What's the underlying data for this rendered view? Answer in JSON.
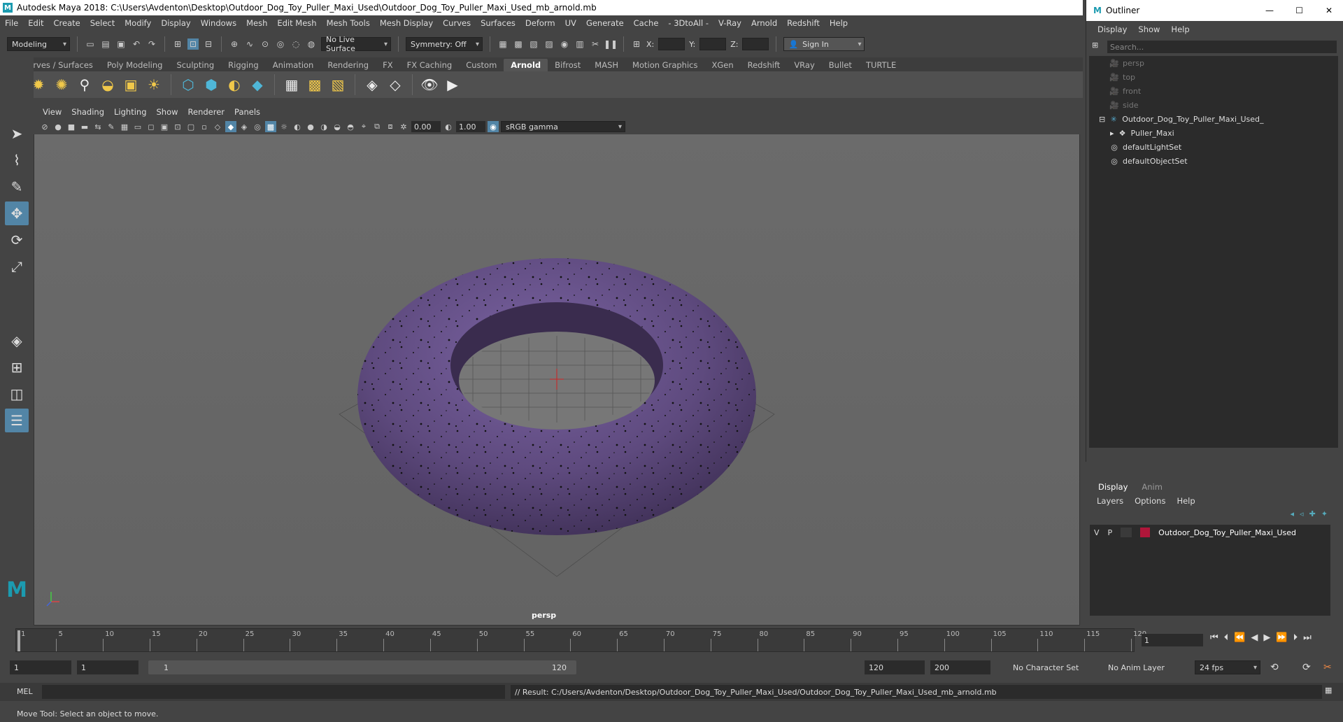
{
  "window": {
    "title": "Autodesk Maya 2018: C:\\Users\\Avdenton\\Desktop\\Outdoor_Dog_Toy_Puller_Maxi_Used\\Outdoor_Dog_Toy_Puller_Maxi_Used_mb_arnold.mb"
  },
  "menubar": [
    "File",
    "Edit",
    "Create",
    "Select",
    "Modify",
    "Display",
    "Windows",
    "Mesh",
    "Edit Mesh",
    "Mesh Tools",
    "Mesh Display",
    "Curves",
    "Surfaces",
    "Deform",
    "UV",
    "Generate",
    "Cache",
    "- 3DtoAll -",
    "V-Ray",
    "Arnold",
    "Redshift",
    "Help"
  ],
  "statusline": {
    "mode": "Modeling",
    "live_surface": "No Live Surface",
    "symmetry": "Symmetry: Off",
    "x_label": "X:",
    "y_label": "Y:",
    "z_label": "Z:",
    "sign_in": "Sign In"
  },
  "shelf_tabs": [
    "Curves / Surfaces",
    "Poly Modeling",
    "Sculpting",
    "Rigging",
    "Animation",
    "Rendering",
    "FX",
    "FX Caching",
    "Custom",
    "Arnold",
    "Bifrost",
    "MASH",
    "Motion Graphics",
    "XGen",
    "Redshift",
    "VRay",
    "Bullet",
    "TURTLE"
  ],
  "shelf_active": "Arnold",
  "viewport": {
    "menu": [
      "View",
      "Shading",
      "Lighting",
      "Show",
      "Renderer",
      "Panels"
    ],
    "exposure": "0.00",
    "gamma": "1.00",
    "color_space": "sRGB gamma",
    "camera_label": "persp",
    "torus_color": "#5e4a7e"
  },
  "outliner": {
    "title": "Outliner",
    "menu": [
      "Display",
      "Show",
      "Help"
    ],
    "search_placeholder": "Search...",
    "items": [
      {
        "label": "persp",
        "dim": true
      },
      {
        "label": "top",
        "dim": true
      },
      {
        "label": "front",
        "dim": true
      },
      {
        "label": "side",
        "dim": true
      },
      {
        "label": "Outdoor_Dog_Toy_Puller_Maxi_Used_",
        "dim": false
      },
      {
        "label": "Puller_Maxi",
        "dim": false
      },
      {
        "label": "defaultLightSet",
        "dim": false
      },
      {
        "label": "defaultObjectSet",
        "dim": false
      }
    ]
  },
  "layers": {
    "tabs": [
      "Display",
      "Anim"
    ],
    "menu": [
      "Layers",
      "Options",
      "Help"
    ],
    "row": {
      "v": "V",
      "p": "P",
      "name": "Outdoor_Dog_Toy_Puller_Maxi_Used",
      "color": "#b0163a"
    }
  },
  "timeline": {
    "ticks": [
      "1",
      "5",
      "10",
      "15",
      "20",
      "25",
      "30",
      "35",
      "40",
      "45",
      "50",
      "55",
      "60",
      "65",
      "70",
      "75",
      "80",
      "85",
      "90",
      "95",
      "100",
      "105",
      "110",
      "115",
      "120"
    ],
    "current_frame": "1"
  },
  "range": {
    "start": "1",
    "start2": "1",
    "slider_start": "1",
    "slider_end": "120",
    "end": "120",
    "end2": "200",
    "character_set": "No Character Set",
    "anim_layer": "No Anim Layer",
    "fps": "24 fps"
  },
  "command": {
    "lang": "MEL",
    "result": "// Result: C:/Users/Avdenton/Desktop/Outdoor_Dog_Toy_Puller_Maxi_Used/Outdoor_Dog_Toy_Puller_Maxi_Used_mb_arnold.mb"
  },
  "help_line": "Move Tool: Select an object to move."
}
